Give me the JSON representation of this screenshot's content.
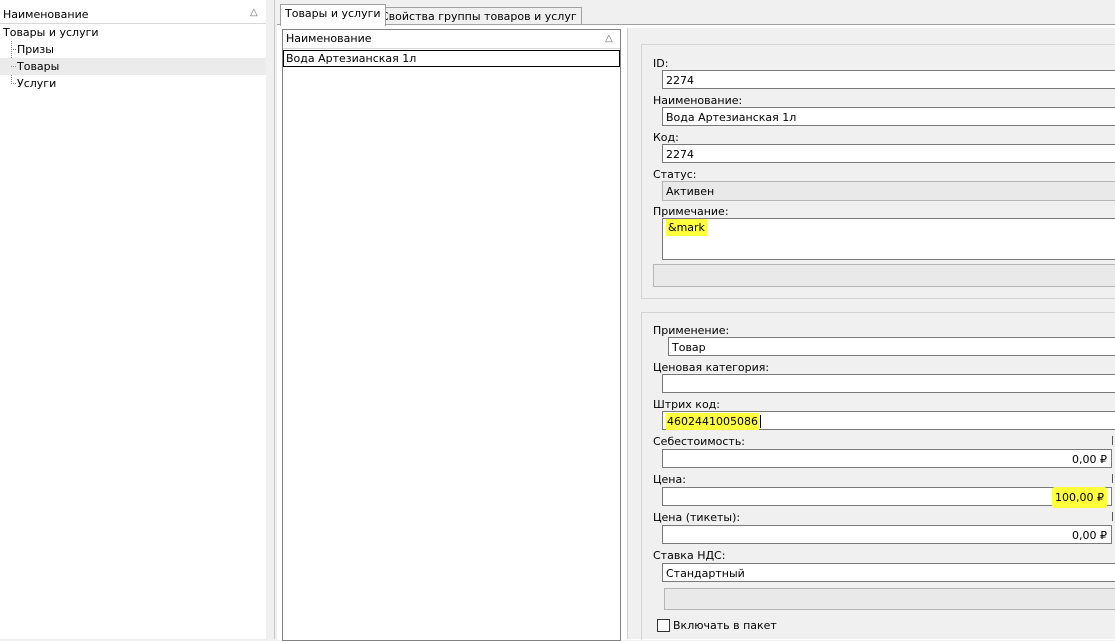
{
  "left_tree": {
    "header": "Наименование",
    "root": "Товары и услуги",
    "children": [
      "Призы",
      "Товары",
      "Услуги"
    ]
  },
  "tabs": [
    "Товары и услуги",
    "Свойства группы товаров и услуг"
  ],
  "items_list": {
    "header": "Наименование",
    "rows": [
      "Вода Артезианская 1л"
    ]
  },
  "form": {
    "id_label": "ID:",
    "id_value": "2274",
    "name_label": "Наименование:",
    "name_value": "Вода Артезианская 1л",
    "code_label": "Код:",
    "code_value": "2274",
    "status_label": "Статус:",
    "status_value": "Активен",
    "note_label": "Примечание:",
    "note_value": "&mark",
    "usage_label": "Применение:",
    "usage_value": "Товар",
    "price_category_label": "Ценовая категория:",
    "price_category_value": "",
    "barcode_label": "Штрих код:",
    "barcode_value": "4602441005086",
    "cost_label": "Себестоимость:",
    "cost_value": "0,00 ₽",
    "price_label": "Цена:",
    "price_value": "100,00 ₽",
    "price_tickets_label": "Цена (тикеты):",
    "price_tickets_value": "0,00 ₽",
    "vat_label": "Ставка НДС:",
    "vat_value": "Стандартный",
    "include_package_label": "Включать в пакет"
  },
  "colors": {
    "highlight": "#ffff3c",
    "selection": "#ebebeb"
  },
  "icons": {
    "sort": "sort-triangle-icon"
  }
}
